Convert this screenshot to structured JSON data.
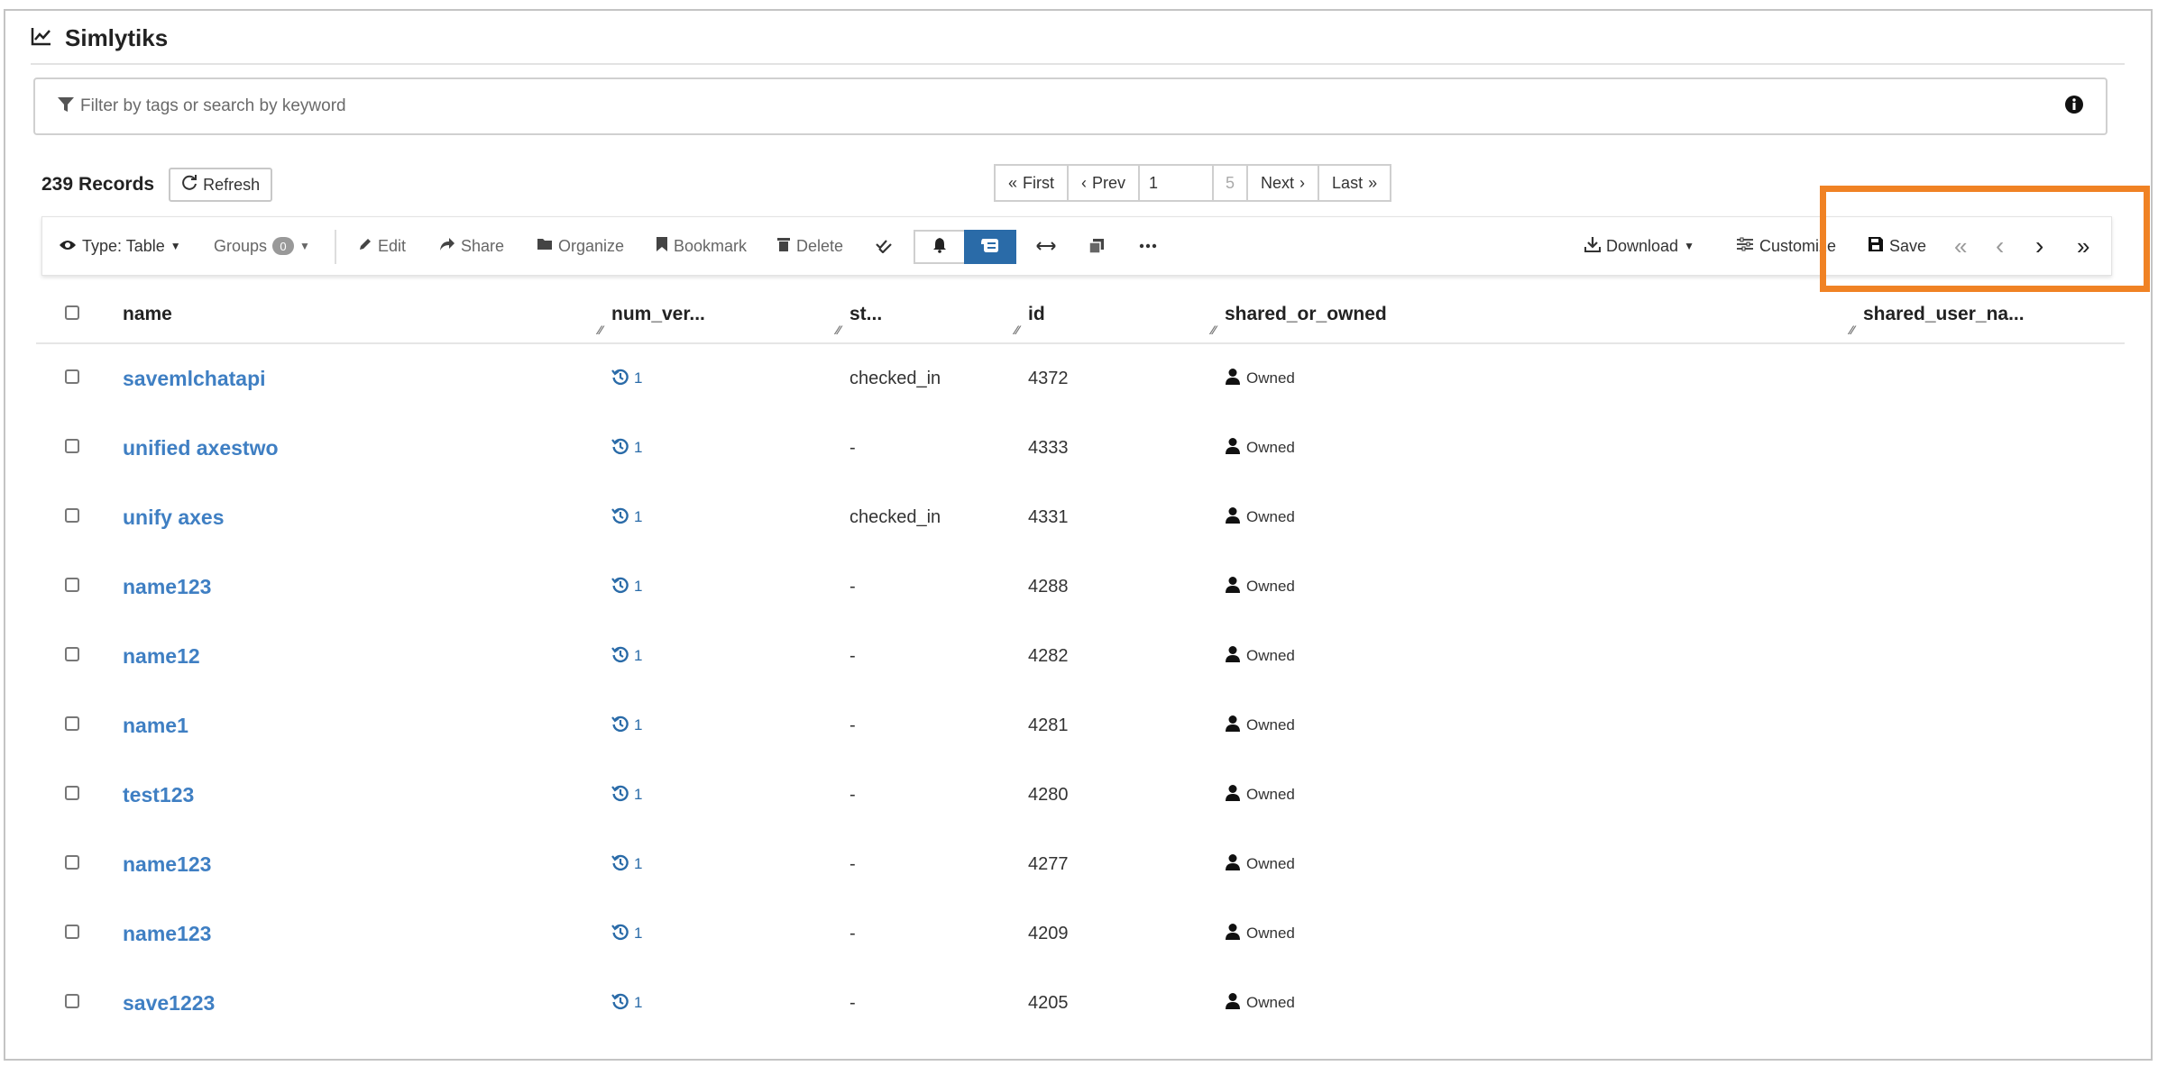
{
  "app": {
    "title": "Simlytiks"
  },
  "search": {
    "placeholder": "Filter by tags or search by keyword"
  },
  "records": {
    "count": "239",
    "label": "Records",
    "refresh_label": "Refresh"
  },
  "pager": {
    "first": "First",
    "prev": "Prev",
    "current": "1",
    "total": "5",
    "next": "Next",
    "last": "Last"
  },
  "toolbar": {
    "type_label": "Type: Table",
    "groups_label": "Groups",
    "groups_count": "0",
    "edit": "Edit",
    "share": "Share",
    "organize": "Organize",
    "bookmark": "Bookmark",
    "delete": "Delete",
    "download": "Download",
    "customize": "Customize",
    "save": "Save"
  },
  "table": {
    "columns": [
      "name",
      "num_ver...",
      "st...",
      "id",
      "shared_or_owned",
      "shared_user_na..."
    ],
    "rows": [
      {
        "name": "savemlchatapi",
        "versions": "1",
        "status": "checked_in",
        "id": "4372",
        "owned": "Owned"
      },
      {
        "name": "unified axestwo",
        "versions": "1",
        "status": "-",
        "id": "4333",
        "owned": "Owned"
      },
      {
        "name": "unify axes",
        "versions": "1",
        "status": "checked_in",
        "id": "4331",
        "owned": "Owned"
      },
      {
        "name": "name123",
        "versions": "1",
        "status": "-",
        "id": "4288",
        "owned": "Owned"
      },
      {
        "name": "name12",
        "versions": "1",
        "status": "-",
        "id": "4282",
        "owned": "Owned"
      },
      {
        "name": "name1",
        "versions": "1",
        "status": "-",
        "id": "4281",
        "owned": "Owned"
      },
      {
        "name": "test123",
        "versions": "1",
        "status": "-",
        "id": "4280",
        "owned": "Owned"
      },
      {
        "name": "name123",
        "versions": "1",
        "status": "-",
        "id": "4277",
        "owned": "Owned"
      },
      {
        "name": "name123",
        "versions": "1",
        "status": "-",
        "id": "4209",
        "owned": "Owned"
      },
      {
        "name": "save1223",
        "versions": "1",
        "status": "-",
        "id": "4205",
        "owned": "Owned"
      }
    ]
  },
  "colors": {
    "link": "#3f7fc3",
    "accent": "#2a6ba8",
    "highlight": "#f08224"
  },
  "icons": [
    "chart-line-icon",
    "filter-icon",
    "info-icon",
    "refresh-icon",
    "eye-icon",
    "pencil-icon",
    "share-icon",
    "folder-icon",
    "bookmark-icon",
    "trash-icon",
    "double-check-icon",
    "bell-icon",
    "scroll-icon",
    "arrows-horizontal-icon",
    "copy-icon",
    "ellipsis-icon",
    "download-icon",
    "sliders-icon",
    "floppy-icon",
    "history-icon",
    "user-icon"
  ]
}
